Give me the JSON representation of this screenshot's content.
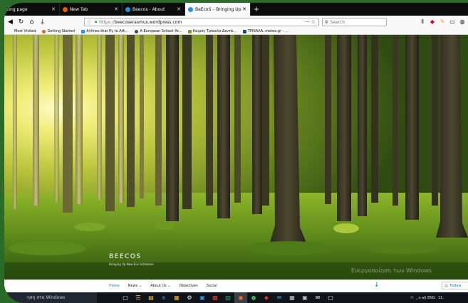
{
  "browser": {
    "tabs": [
      {
        "title": "ting page",
        "favicon_color": "#d7d7db",
        "active": false
      },
      {
        "title": "New Tab",
        "favicon_color": "#e66000",
        "active": false
      },
      {
        "title": "Beecos - About",
        "favicon_color": "#2a8fd6",
        "active": false
      },
      {
        "title": "BeEcoS – Bringing Up New Eco",
        "favicon_color": "#2a8fd6",
        "active": true
      }
    ],
    "tab_close_glyph": "✕",
    "new_tab_glyph": "+",
    "url_prefix": "https://",
    "url_host": "beecoserasmus.wordpress.com",
    "url_actions": "··· ☆",
    "search_placeholder": "Search"
  },
  "bookmarks": [
    {
      "label": "Most Visited",
      "color": "#ff9400"
    },
    {
      "label": "Getting Started",
      "color": "#e66000"
    },
    {
      "label": "Airlines that fly to Ath...",
      "color": "#2a8fd6"
    },
    {
      "label": "A European School Ar...",
      "color": "#4a4a4f"
    },
    {
      "label": "Καιρός Τρίκαλα Δεντά...",
      "color": "#7a9a2a"
    },
    {
      "label": "ΤΡΙΚΑΛΑ: meteo.gr - ...",
      "color": "#1b3c8f"
    }
  ],
  "site": {
    "title": "BEECOS",
    "tagline": "Bringing Up New Eco Schoolers",
    "menu": [
      "Home",
      "News ⌄",
      "About Us ⌄",
      "Objectives",
      "Social"
    ],
    "follow_label": "Follow",
    "scroll_arrow": "↓"
  },
  "watermark": "Ενεργοποίηση των Windows",
  "taskbar": {
    "search_text": "ηση στα Windows",
    "apps": [
      "▢",
      "☰",
      "▤",
      "e",
      "▦",
      "⚙",
      "▣",
      "▩",
      "▧",
      "◉",
      "●",
      "◆",
      "✉",
      "▦",
      "▣",
      "✉",
      "▢"
    ],
    "tray": "⁁ ⌂ ◂)) ENG",
    "clock": "11:"
  },
  "colors": {
    "accent": "#1279be",
    "tab_bg": "#0c0c0d"
  }
}
